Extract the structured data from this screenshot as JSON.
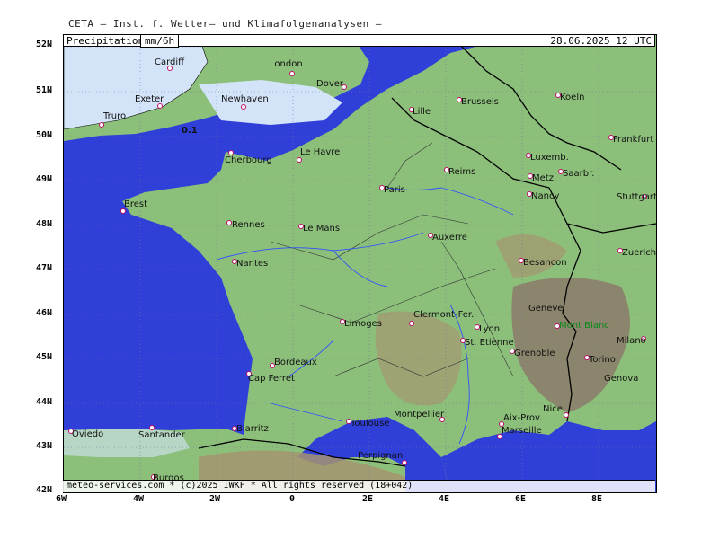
{
  "header": {
    "title": "CETA – Inst. f. Wetter– und Klimafolgenanalysen –"
  },
  "label_bar": {
    "parameter": "Precipitation",
    "unit": "mm/6h",
    "datetime": "28.06.2025 12 UTC"
  },
  "footer": {
    "copyright": "meteo-services.com * (c)2025 IWKF * All rights reserved (18+042)"
  },
  "axes": {
    "latitude": [
      "52N",
      "51N",
      "50N",
      "49N",
      "48N",
      "47N",
      "46N",
      "45N",
      "44N",
      "43N",
      "42N"
    ],
    "longitude": [
      "6W",
      "4W",
      "2W",
      "0",
      "2E",
      "4E",
      "6E",
      "8E"
    ]
  },
  "contour_label": "0.1",
  "colors": {
    "sea": "#2f3fd8",
    "land": "#8cc07a",
    "mountain": "#8a7a6a",
    "precip": "#d4e4f8",
    "border": "#000000",
    "river": "#3050ff"
  },
  "cities": [
    {
      "name": "Cardiff"
    },
    {
      "name": "London"
    },
    {
      "name": "Exeter"
    },
    {
      "name": "Dover"
    },
    {
      "name": "Truro"
    },
    {
      "name": "Newhaven"
    },
    {
      "name": "Lille"
    },
    {
      "name": "Brussels"
    },
    {
      "name": "Koeln"
    },
    {
      "name": "Frankfurt"
    },
    {
      "name": "Le Havre"
    },
    {
      "name": "Cherbourg"
    },
    {
      "name": "Luxemb."
    },
    {
      "name": "Reims"
    },
    {
      "name": "Metz"
    },
    {
      "name": "Saarbr."
    },
    {
      "name": "Paris"
    },
    {
      "name": "Nancy"
    },
    {
      "name": "Stuttgart"
    },
    {
      "name": "Brest"
    },
    {
      "name": "Rennes"
    },
    {
      "name": "Le Mans"
    },
    {
      "name": "Auxerre"
    },
    {
      "name": "Nantes"
    },
    {
      "name": "Besancon"
    },
    {
      "name": "Zuerich"
    },
    {
      "name": "Geneve"
    },
    {
      "name": "Limoges"
    },
    {
      "name": "Clermont-Fer."
    },
    {
      "name": "Lyon"
    },
    {
      "name": "Mont Blanc"
    },
    {
      "name": "St. Etienne"
    },
    {
      "name": "Milano"
    },
    {
      "name": "Bordeaux"
    },
    {
      "name": "Grenoble"
    },
    {
      "name": "Torino"
    },
    {
      "name": "Cap Ferret"
    },
    {
      "name": "Genova"
    },
    {
      "name": "Montpellier"
    },
    {
      "name": "Nice"
    },
    {
      "name": "Toulouse"
    },
    {
      "name": "Aix-Prov."
    },
    {
      "name": "Oviedo"
    },
    {
      "name": "Santander"
    },
    {
      "name": "Biarritz"
    },
    {
      "name": "Marseille"
    },
    {
      "name": "Perpignan"
    },
    {
      "name": "Burgos"
    }
  ]
}
